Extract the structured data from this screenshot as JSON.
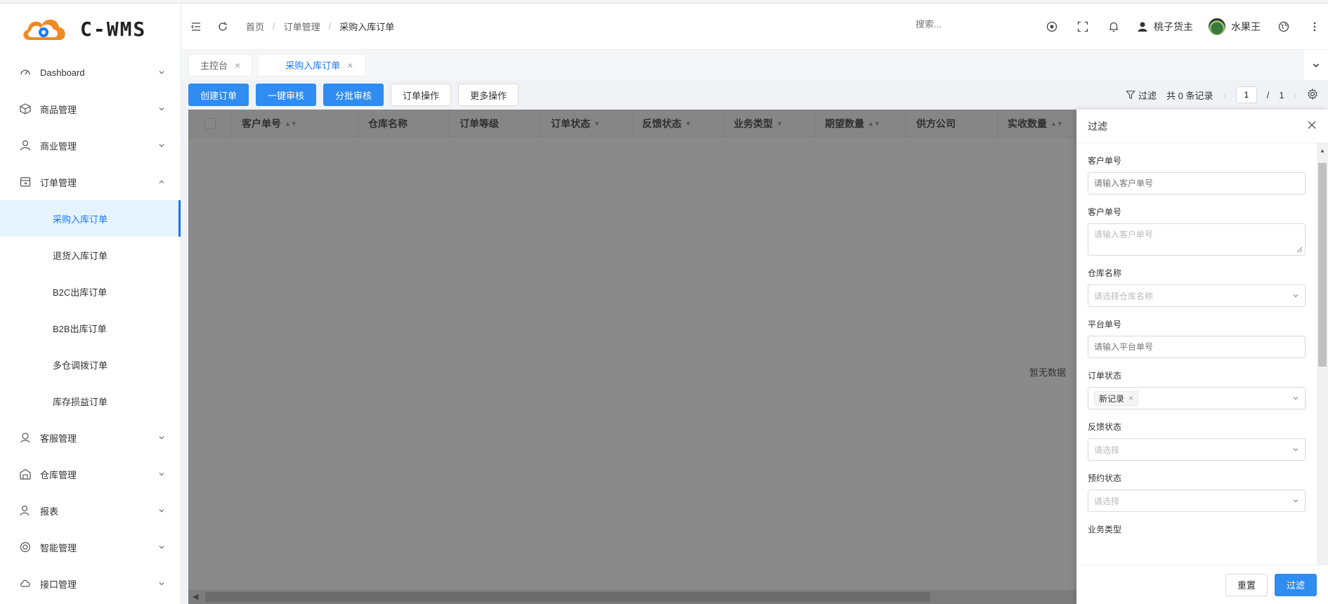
{
  "app": {
    "logo_text": "C-WMS",
    "colors": {
      "primary": "#2f8cf0",
      "logo_orange": "#f08a24",
      "logo_blue": "#1677ff"
    }
  },
  "sidebar": {
    "items": [
      {
        "label": "Dashboard",
        "icon": "dashboard-icon",
        "expanded": false
      },
      {
        "label": "商品管理",
        "icon": "package-icon",
        "expanded": false
      },
      {
        "label": "商业管理",
        "icon": "user-icon",
        "expanded": false
      },
      {
        "label": "订单管理",
        "icon": "order-icon",
        "expanded": true,
        "children": [
          {
            "label": "采购入库订单",
            "active": true
          },
          {
            "label": "退货入库订单"
          },
          {
            "label": "B2C出库订单"
          },
          {
            "label": "B2B出库订单"
          },
          {
            "label": "多仓调拨订单"
          },
          {
            "label": "库存损益订单"
          }
        ]
      },
      {
        "label": "客服管理",
        "icon": "headset-icon",
        "expanded": false
      },
      {
        "label": "仓库管理",
        "icon": "warehouse-icon",
        "expanded": false
      },
      {
        "label": "报表",
        "icon": "report-icon",
        "expanded": false
      },
      {
        "label": "智能管理",
        "icon": "smart-icon",
        "expanded": false
      },
      {
        "label": "接口管理",
        "icon": "api-icon",
        "expanded": false
      }
    ]
  },
  "header": {
    "breadcrumb": [
      "首页",
      "订单管理",
      "采购入库订单"
    ],
    "search_placeholder": "搜索...",
    "user_role": "桃子货主",
    "user_name": "水果王"
  },
  "tabs": [
    {
      "label": "主控台",
      "active": false
    },
    {
      "label": "采购入库订单",
      "active": true
    }
  ],
  "toolbar": {
    "create_order": "创建订单",
    "one_click_audit": "一键审核",
    "batch_audit": "分批审核",
    "order_ops": "订单操作",
    "more_ops": "更多操作",
    "filter_label": "过滤",
    "record_count": "共 0 条记录",
    "page_current": "1",
    "page_sep": "/",
    "page_total": "1"
  },
  "table": {
    "columns": [
      "客户单号",
      "仓库名称",
      "订单等级",
      "订单状态",
      "反馈状态",
      "业务类型",
      "期望数量",
      "供方公司",
      "实收数量"
    ],
    "empty_text": "暂无数据"
  },
  "filter_panel": {
    "title": "过滤",
    "fields": [
      {
        "label": "客户单号",
        "placeholder": "请输入客户单号",
        "type": "input"
      },
      {
        "label": "客户单号",
        "placeholder": "请输入客户单号",
        "type": "textarea"
      },
      {
        "label": "仓库名称",
        "placeholder": "请选择仓库名称",
        "type": "select"
      },
      {
        "label": "平台单号",
        "placeholder": "请输入平台单号",
        "type": "input"
      },
      {
        "label": "订单状态",
        "tag": "新记录",
        "type": "tag-select"
      },
      {
        "label": "反馈状态",
        "placeholder": "请选择",
        "type": "select"
      },
      {
        "label": "预约状态",
        "placeholder": "请选择",
        "type": "select"
      },
      {
        "label": "业务类型",
        "type": "label-only"
      }
    ],
    "reset_label": "重置",
    "submit_label": "过滤"
  }
}
